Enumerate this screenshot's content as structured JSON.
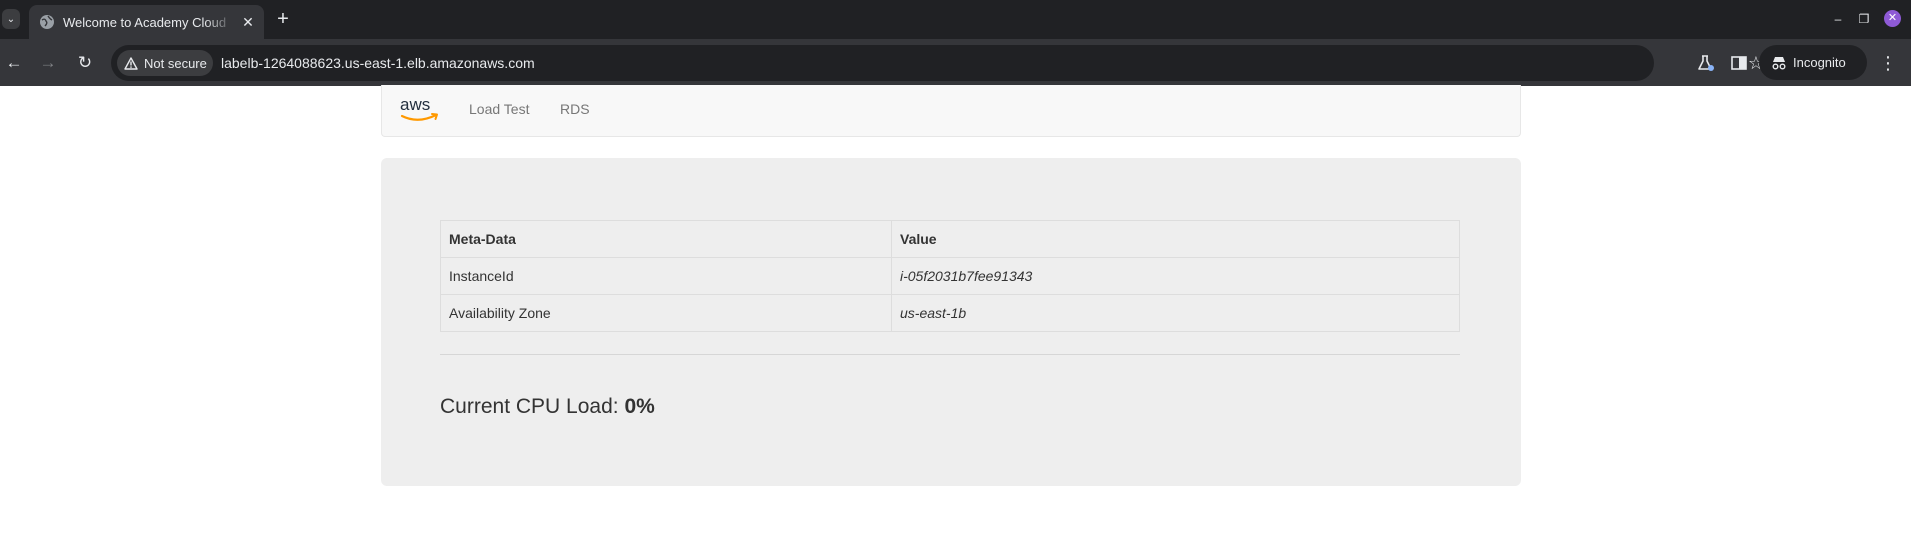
{
  "browser": {
    "tab_title": "Welcome to Academy Cloud",
    "tab_close": "✕",
    "new_tab": "+",
    "security_label": "Not secure",
    "url": "labelb-1264088623.us-east-1.elb.amazonaws.com",
    "profile_label": "Incognito"
  },
  "nav": {
    "logo_text": "aws",
    "links": [
      "Load Test",
      "RDS"
    ]
  },
  "metadata_table": {
    "headers": [
      "Meta-Data",
      "Value"
    ],
    "rows": [
      [
        "InstanceId",
        "i-05f2031b7fee91343"
      ],
      [
        "Availability Zone",
        "us-east-1b"
      ]
    ]
  },
  "cpu": {
    "label": "Current CPU Load:",
    "value": "0%"
  },
  "colors": {
    "chrome_dark": "#202124",
    "chrome_toolbar": "#35363a",
    "navbar_bg": "#f8f8f8",
    "jumbotron_bg": "#eeeeee",
    "aws_orange": "#ff9900",
    "aws_text": "#232f3e"
  }
}
